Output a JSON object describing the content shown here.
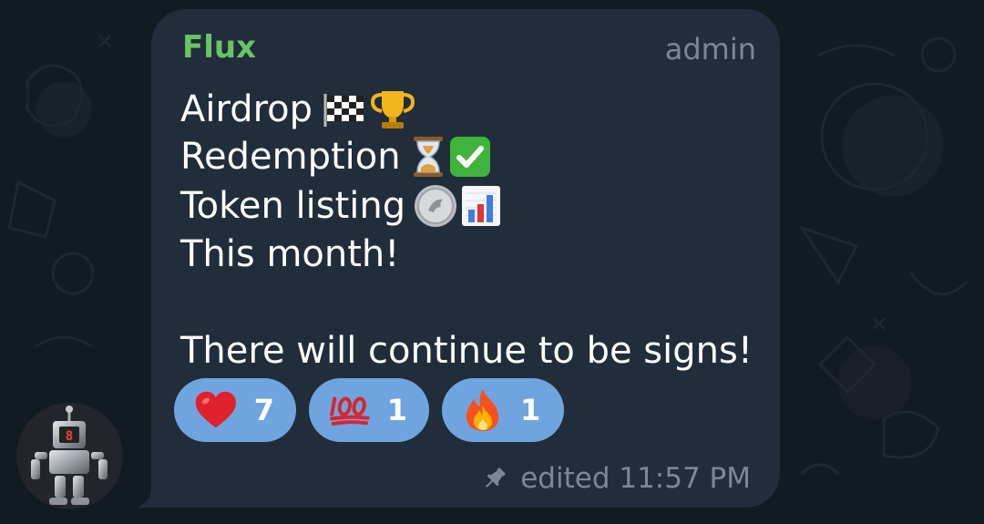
{
  "message": {
    "sender": "Flux",
    "role": "admin",
    "lines": [
      {
        "text": "Airdrop",
        "icons": [
          "checkered-flag-icon",
          "trophy-icon"
        ]
      },
      {
        "text": "Redemption",
        "icons": [
          "hourglass-icon",
          "check-mark-button-icon"
        ]
      },
      {
        "text": "Token listing",
        "icons": [
          "coin-icon",
          "bar-chart-icon"
        ]
      },
      {
        "text": "This month!",
        "icons": []
      },
      {
        "text": "There will continue to be signs!",
        "icons": []
      }
    ],
    "reactions": [
      {
        "icon": "red-heart-icon",
        "count": "7"
      },
      {
        "icon": "hundred-points-icon",
        "count": "1"
      },
      {
        "icon": "fire-icon",
        "count": "1"
      }
    ],
    "footer": {
      "icon": "pin-icon",
      "status": "edited 11:57 PM"
    }
  },
  "colors": {
    "background": "#121a22",
    "bubble": "#212d3b",
    "sender": "#6cc264",
    "meta": "#7a8896",
    "reaction_pill": "#6fa4de"
  }
}
